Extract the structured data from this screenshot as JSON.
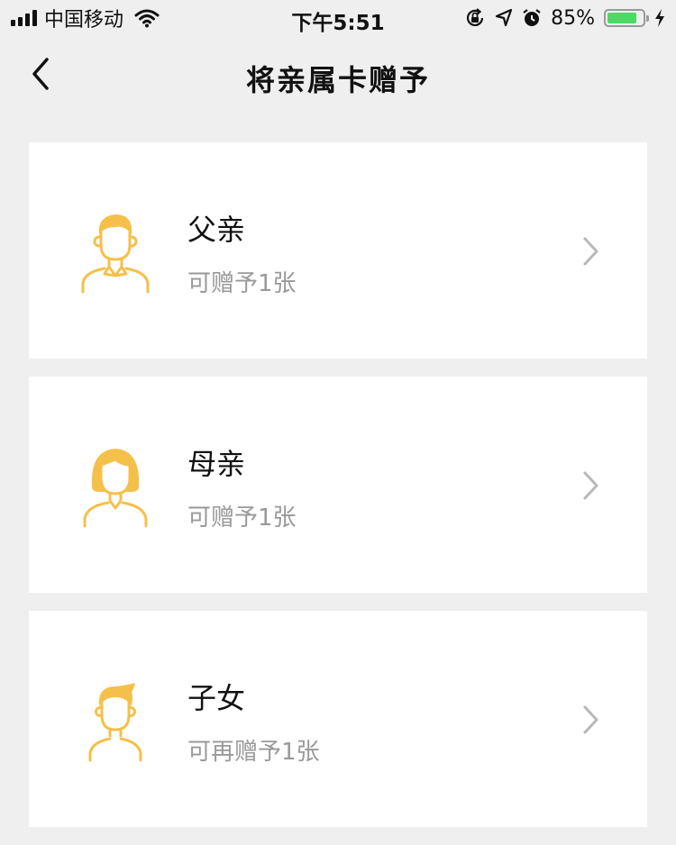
{
  "status_bar": {
    "carrier": "中国移动",
    "time": "下午5:51",
    "battery_percent_text": "85%",
    "battery_level": 0.85,
    "icons": [
      "signal-icon",
      "wifi-icon",
      "orientation-lock-icon",
      "location-icon",
      "alarm-icon",
      "battery-icon",
      "charging-icon"
    ]
  },
  "nav": {
    "title": "将亲属卡赠予",
    "back_icon": "chevron-left-icon"
  },
  "cards": [
    {
      "name": "父亲",
      "subtitle": "可赠予1张",
      "avatar_icon": "father-avatar-icon"
    },
    {
      "name": "母亲",
      "subtitle": "可赠予1张",
      "avatar_icon": "mother-avatar-icon"
    },
    {
      "name": "子女",
      "subtitle": "可再赠予1张",
      "avatar_icon": "child-avatar-icon"
    }
  ],
  "colors": {
    "background": "#efefef",
    "card": "#ffffff",
    "avatar": "#f5c04a",
    "subtitle": "#999999",
    "chevron": "#b8b8b8",
    "battery": "#4cd964"
  }
}
